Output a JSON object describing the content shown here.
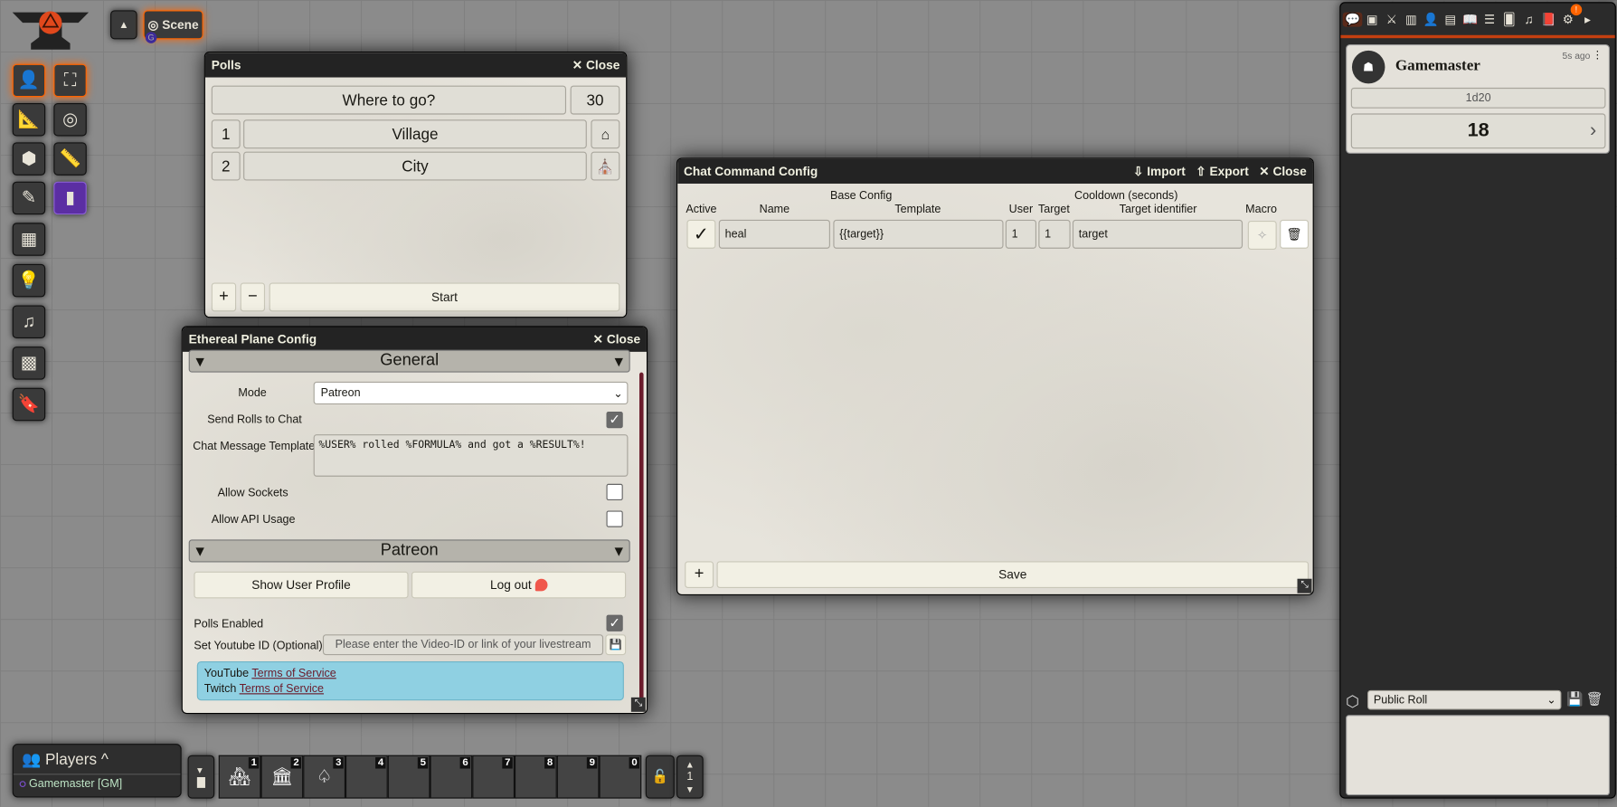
{
  "nav": {
    "scene_label": "Scene",
    "badge": "G"
  },
  "controls": [
    {
      "icon": "token-icon",
      "glyph": "👤"
    },
    {
      "icon": "fullscreen-icon",
      "glyph": "⛶"
    },
    {
      "icon": "measure-icon",
      "glyph": "📐"
    },
    {
      "icon": "target-icon",
      "glyph": "◎"
    },
    {
      "icon": "tiles-icon",
      "glyph": "⬢"
    },
    {
      "icon": "ruler-icon",
      "glyph": "📏"
    },
    {
      "icon": "pencil-icon",
      "glyph": "✎"
    },
    {
      "icon": "poll-icon",
      "glyph": "▮"
    },
    {
      "icon": "walls-icon",
      "glyph": "▦"
    },
    {
      "icon": "lightbulb-icon",
      "glyph": "💡"
    },
    {
      "icon": "music-icon",
      "glyph": "♫"
    },
    {
      "icon": "checker-icon",
      "glyph": "▩"
    },
    {
      "icon": "bookmark-icon",
      "glyph": "🔖"
    }
  ],
  "polls": {
    "title": "Polls",
    "close": "Close",
    "question": "Where to go?",
    "duration": "30",
    "options": [
      {
        "num": "1",
        "label": "Village"
      },
      {
        "num": "2",
        "label": "City"
      }
    ],
    "add": "+",
    "remove": "−",
    "start": "Start"
  },
  "ethereal": {
    "title": "Ethereal Plane Config",
    "close": "Close",
    "general": "General",
    "mode_label": "Mode",
    "mode_value": "Patreon",
    "send_rolls": "Send Rolls to Chat",
    "template_label": "Chat Message Template",
    "template_value": "%USER% rolled %FORMULA% and got a %RESULT%!",
    "allow_sockets": "Allow Sockets",
    "allow_api": "Allow API Usage",
    "patreon": "Patreon",
    "show_profile": "Show User Profile",
    "logout": "Log out",
    "polls_enabled": "Polls Enabled",
    "youtube_label": "Set Youtube ID (Optional)",
    "youtube_placeholder": "Please enter the Video-ID or link of your livestream",
    "youtube_prefix": "YouTube",
    "twitch_prefix": "Twitch",
    "tos": "Terms of Service",
    "checks": {
      "send_rolls": true,
      "allow_sockets": false,
      "allow_api": false,
      "polls_enabled": true
    }
  },
  "chatcmd": {
    "title": "Chat Command Config",
    "import": "Import",
    "export": "Export",
    "close": "Close",
    "group_base": "Base Config",
    "group_cooldown": "Cooldown (seconds)",
    "cols": {
      "active": "Active",
      "name": "Name",
      "template": "Template",
      "user": "User",
      "target": "Target",
      "target_id": "Target identifier",
      "macro": "Macro"
    },
    "row": {
      "active": true,
      "name": "heal",
      "template": "{{target}}",
      "user": "1",
      "target": "1",
      "target_id": "target"
    },
    "add": "+",
    "save": "Save"
  },
  "sidebar": {
    "tabs": [
      "chat-icon",
      "combat-tracker-icon",
      "combat-icon",
      "scenes-icon",
      "actors-icon",
      "items-icon",
      "journal-icon",
      "tables-icon",
      "cards-icon",
      "playlists-icon",
      "compendium-icon",
      "settings-icon"
    ],
    "settings_badge": "!",
    "message": {
      "author": "Gamemaster",
      "time": "5s ago",
      "formula": "1d20",
      "result": "18"
    },
    "roll_mode": "Public Roll"
  },
  "players": {
    "title": "Players",
    "list": [
      {
        "name": "Gamemaster [GM]",
        "color": "#7b4fd0"
      }
    ]
  },
  "hotbar": {
    "slots": [
      "1",
      "2",
      "3",
      "4",
      "5",
      "6",
      "7",
      "8",
      "9",
      "0"
    ],
    "page": "1"
  }
}
